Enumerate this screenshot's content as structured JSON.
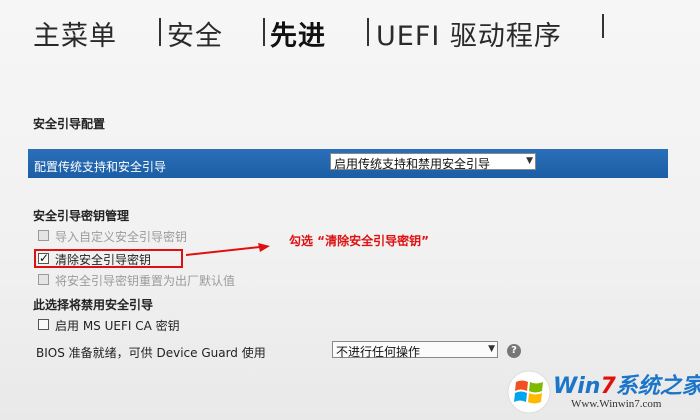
{
  "tabs": {
    "main_menu": "主菜单",
    "security": "安全",
    "advanced": "先进",
    "uefi_drivers": "UEFI 驱动程序"
  },
  "secure_boot": {
    "section_title": "安全引导配置",
    "config_label": "配置传统支持和安全引导",
    "config_value": "启用传统支持和禁用安全引导"
  },
  "key_management": {
    "title": "安全引导密钥管理",
    "options": [
      {
        "label": "导入自定义安全引导密钥",
        "checked": false,
        "enabled": false
      },
      {
        "label": "清除安全引导密钥",
        "checked": true,
        "enabled": true
      },
      {
        "label": "将安全引导密钥重置为出厂默认值",
        "checked": false,
        "enabled": false
      }
    ]
  },
  "disable_secure": {
    "title": "此选择将禁用安全引导",
    "option_label": "启用 MS UEFI CA 密钥"
  },
  "bios_ready": {
    "label": "BIOS 准备就绪，可供 Device Guard 使用",
    "value": "不进行任何操作",
    "help_icon": "?"
  },
  "annotation": {
    "text": "勾选 “清除安全引导密钥”"
  },
  "watermark": {
    "brand_prefix": "Win",
    "brand_num": "7",
    "brand_suffix": "系统之家",
    "url": "Www.Winwin7.com"
  },
  "colors": {
    "highlight_bg": "#1f63ad",
    "annotation_red": "#e01010"
  }
}
